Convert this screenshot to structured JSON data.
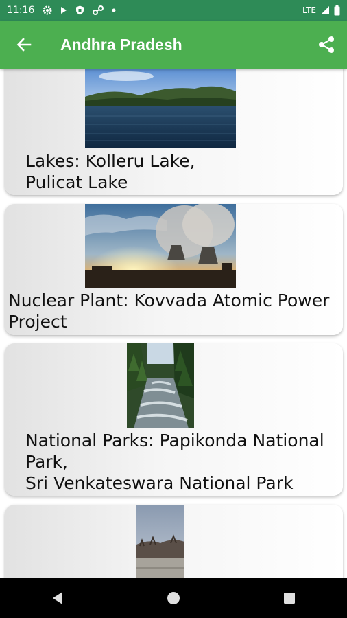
{
  "status_bar": {
    "time": "11:16",
    "network": "LTE"
  },
  "app_bar": {
    "title": "Andhra Pradesh",
    "back_icon": "arrow-back-icon",
    "share_icon": "share-icon"
  },
  "colors": {
    "status_bar": "#2e8b57",
    "app_bar": "#4caf50",
    "nav_bar": "#000000"
  },
  "cards": [
    {
      "label": "Lakes:",
      "value_lines": [
        "Kolleru Lake,",
        "Pulicat Lake"
      ],
      "image": "lake-photo"
    },
    {
      "label": "Nuclear Plant:",
      "value_lines": [
        "Kovvada Atomic Power",
        "Project"
      ],
      "image": "nuclear-plant-photo"
    },
    {
      "label": "National Parks:",
      "value_lines": [
        "Papikonda National",
        "Park,",
        "Sri Venkateswara National Park"
      ],
      "image": "forest-river-photo"
    },
    {
      "label": "",
      "value_lines": [],
      "image": "landscape-photo"
    }
  ],
  "nav_bar": {
    "back": "nav-back-icon",
    "home": "nav-home-icon",
    "recents": "nav-recents-icon"
  }
}
